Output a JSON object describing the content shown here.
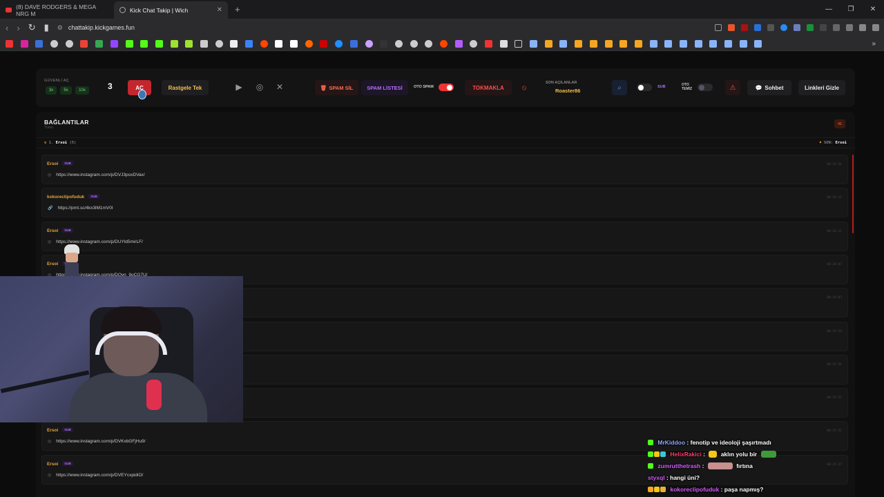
{
  "browser": {
    "tabs": [
      {
        "title": "(8) DAVE RODGERS & MEGA NRG M",
        "active": false,
        "icon": "youtube-icon"
      },
      {
        "title": "Kick Chat Takip | Wich",
        "active": true,
        "icon": "globe-icon"
      }
    ],
    "url": "chattakip.kickgames.fun"
  },
  "toolbar": {
    "guvenli_label": "GÜVENLİ AÇ",
    "multipliers": [
      "3x",
      "5x",
      "10x"
    ],
    "count": "3",
    "ac_label": "AÇ",
    "rastgele_label": "Rastgele Tek",
    "spam_sil_label": "SPAM SİL",
    "spam_listesi_label": "SPAM LİSTESİ",
    "oto_spam_label": "OTO SPAM",
    "oto_spam_on": true,
    "tokmakla_label": "TOKMAKLA",
    "son_acilanlar_label": "SON AÇILANLAR",
    "son_acilanlar_value": "Roaster86",
    "sub_label": "SUB",
    "oto_temiz_label": "OTO TEMİZ",
    "sohbet_label": "Sohbet",
    "linkleri_gizle_label": "Linkleri Gizle",
    "accent_red": "#c3262d",
    "accent_gold": "#f2c14e",
    "accent_purple": "#b46bff"
  },
  "panel": {
    "title": "BAĞLANTILAR",
    "subtitle": "Tümü",
    "badge": "41",
    "stat_left_rank": "1.",
    "stat_left_user": "Ersoi",
    "stat_left_count": "(5)",
    "stat_right_label": "SON:",
    "stat_right_user": "Ersoi",
    "rows": [
      {
        "user": "Ersoi",
        "sub": "SUB",
        "link": "https://www.instagram.com/p/DVJ3poxDVax/",
        "time": "00:26:16",
        "icon": "instagram-icon"
      },
      {
        "user": "kokoreclipofuduk",
        "sub": "SUB",
        "link": "https://prnt.sc/4kx3lM1mV0I",
        "time": "00:26:15",
        "icon": "link-icon"
      },
      {
        "user": "Ersoi",
        "sub": "SUB",
        "link": "https://www.instagram.com/p/DUYld5mirLF/",
        "time": "00:26:12",
        "icon": "instagram-icon"
      },
      {
        "user": "Ersoi",
        "sub": "SUB",
        "link": "https://www.instagram.com/p/DQvn_9oCG7U/",
        "time": "00:26:07",
        "icon": "instagram-icon"
      },
      {
        "user": "",
        "sub": "",
        "link": "",
        "time": "00:26:03",
        "icon": ""
      },
      {
        "user": "",
        "sub": "",
        "link": "",
        "time": "00:25:58",
        "icon": ""
      },
      {
        "user": "",
        "sub": "",
        "link": "",
        "time": "00:25:56",
        "icon": ""
      },
      {
        "user": "",
        "sub": "",
        "link": "",
        "time": "00:25:55",
        "icon": ""
      },
      {
        "user": "Ersoi",
        "sub": "SUB",
        "link": "https://www.instagram.com/p/DVKxbGFjHu9/",
        "time": "00:25:51",
        "icon": "instagram-icon"
      },
      {
        "user": "Ersoi",
        "sub": "SUB",
        "link": "https://www.instagram.com/p/DVEYcxpidiO/",
        "time": "00:25:47",
        "icon": "instagram-icon"
      }
    ]
  },
  "chat_overlay": [
    {
      "user": "MrKiddoo",
      "user_color": "#8fa8ff",
      "text": "fenotip ve ideoloji şaşırtmadı"
    },
    {
      "user": "HelixRakici",
      "user_color": "#ff3e6c",
      "text": "aklın yolu bir"
    },
    {
      "user": "zumrutthetrash",
      "user_color": "#d65cff",
      "text": "fırtına"
    },
    {
      "user": "styxql",
      "user_color": "#d65cff",
      "text": "hangi üni?"
    },
    {
      "user": "kokoreclipofuduk",
      "user_color": "#d65cff",
      "text": "paşa napmış?"
    }
  ]
}
